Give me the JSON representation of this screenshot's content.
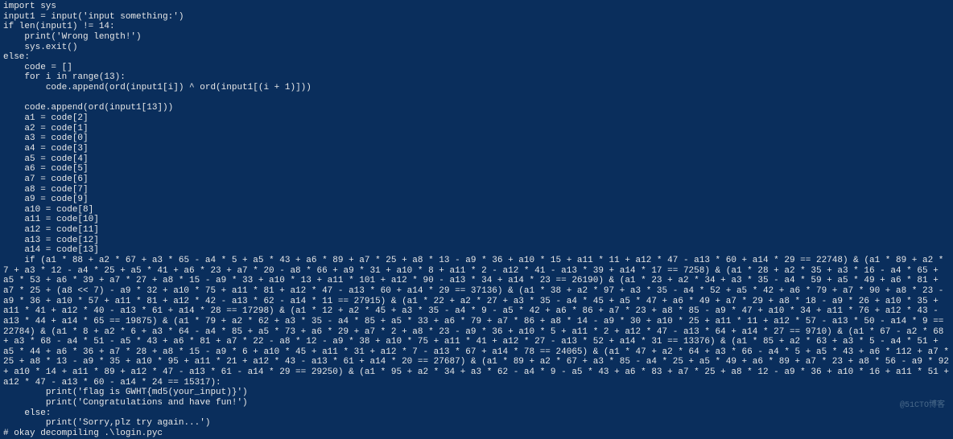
{
  "code": {
    "line1": "import sys",
    "line2": "input1 = input('input something:')",
    "line3": "if len(input1) != 14:",
    "line4": "    print('Wrong length!')",
    "line5": "    sys.exit()",
    "line6": "else:",
    "line7": "    code = []",
    "line8": "    for i in range(13):",
    "line9": "        code.append(ord(input1[i]) ^ ord(input1[(i + 1)]))",
    "line10": "",
    "line11": "    code.append(ord(input1[13]))",
    "line12": "    a1 = code[2]",
    "line13": "    a2 = code[1]",
    "line14": "    a3 = code[0]",
    "line15": "    a4 = code[3]",
    "line16": "    a5 = code[4]",
    "line17": "    a6 = code[5]",
    "line18": "    a7 = code[6]",
    "line19": "    a8 = code[7]",
    "line20": "    a9 = code[9]",
    "line21": "    a10 = code[8]",
    "line22": "    a11 = code[10]",
    "line23": "    a12 = code[11]",
    "line24": "    a13 = code[12]",
    "line25": "    a14 = code[13]",
    "condition": "    if (a1 * 88 + a2 * 67 + a3 * 65 - a4 * 5 + a5 * 43 + a6 * 89 + a7 * 25 + a8 * 13 - a9 * 36 + a10 * 15 + a11 * 11 + a12 * 47 - a13 * 60 + a14 * 29 == 22748) & (a1 * 89 + a2 * 7 + a3 * 12 - a4 * 25 + a5 * 41 + a6 * 23 + a7 * 20 - a8 * 66 + a9 * 31 + a10 * 8 + a11 * 2 - a12 * 41 - a13 * 39 + a14 * 17 == 7258) & (a1 * 28 + a2 * 35 + a3 * 16 - a4 * 65 + a5 * 53 + a6 * 39 + a7 * 27 + a8 * 15 - a9 * 33 + a10 * 13 + a11 * 101 + a12 * 90 - a13 * 34 + a14 * 23 == 26190) & (a1 * 23 + a2 * 34 + a3 * 35 - a4 * 59 + a5 * 49 + a6 * 81 + a7 * 25 + (a8 << 7) - a9 * 32 + a10 * 75 + a11 * 81 + a12 * 47 - a13 * 60 + a14 * 29 == 37136) & (a1 * 38 + a2 * 97 + a3 * 35 - a4 * 52 + a5 * 42 + a6 * 79 + a7 * 90 + a8 * 23 - a9 * 36 + a10 * 57 + a11 * 81 + a12 * 42 - a13 * 62 - a14 * 11 == 27915) & (a1 * 22 + a2 * 27 + a3 * 35 - a4 * 45 + a5 * 47 + a6 * 49 + a7 * 29 + a8 * 18 - a9 * 26 + a10 * 35 + a11 * 41 + a12 * 40 - a13 * 61 + a14 * 28 == 17298) & (a1 * 12 + a2 * 45 + a3 * 35 - a4 * 9 - a5 * 42 + a6 * 86 + a7 * 23 + a8 * 85 - a9 * 47 + a10 * 34 + a11 * 76 + a12 * 43 - a13 * 44 + a14 * 65 == 19875) & (a1 * 79 + a2 * 62 + a3 * 35 - a4 * 85 + a5 * 33 + a6 * 79 + a7 * 86 + a8 * 14 - a9 * 30 + a10 * 25 + a11 * 11 + a12 * 57 - a13 * 50 - a14 * 9 == 22784) & (a1 * 8 + a2 * 6 + a3 * 64 - a4 * 85 + a5 * 73 + a6 * 29 + a7 * 2 + a8 * 23 - a9 * 36 + a10 * 5 + a11 * 2 + a12 * 47 - a13 * 64 + a14 * 27 == 9710) & (a1 * 67 - a2 * 68 + a3 * 68 - a4 * 51 - a5 * 43 + a6 * 81 + a7 * 22 - a8 * 12 - a9 * 38 + a10 * 75 + a11 * 41 + a12 * 27 - a13 * 52 + a14 * 31 == 13376) & (a1 * 85 + a2 * 63 + a3 * 5 - a4 * 51 + a5 * 44 + a6 * 36 + a7 * 28 + a8 * 15 - a9 * 6 + a10 * 45 + a11 * 31 + a12 * 7 - a13 * 67 + a14 * 78 == 24065) & (a1 * 47 + a2 * 64 + a3 * 66 - a4 * 5 + a5 * 43 + a6 * 112 + a7 * 25 + a8 * 13 - a9 * 35 + a10 * 95 + a11 * 21 + a12 * 43 - a13 * 61 + a14 * 20 == 27687) & (a1 * 89 + a2 * 67 + a3 * 85 - a4 * 25 + a5 * 49 + a6 * 89 + a7 * 23 + a8 * 56 - a9 * 92 + a10 * 14 + a11 * 89 + a12 * 47 - a13 * 61 - a14 * 29 == 29250) & (a1 * 95 + a2 * 34 + a3 * 62 - a4 * 9 - a5 * 43 + a6 * 83 + a7 * 25 + a8 * 12 - a9 * 36 + a10 * 16 + a11 * 51 + a12 * 47 - a13 * 60 - a14 * 24 == 15317):",
    "line27": "        print('flag is GWHT{md5(your_input)}')",
    "line28": "        print('Congratulations and have fun!')",
    "line29": "    else:",
    "line30": "        print('Sorry,plz try again...')",
    "line31": "# okay decompiling .\\login.pyc"
  },
  "watermark": "@51CTO博客"
}
